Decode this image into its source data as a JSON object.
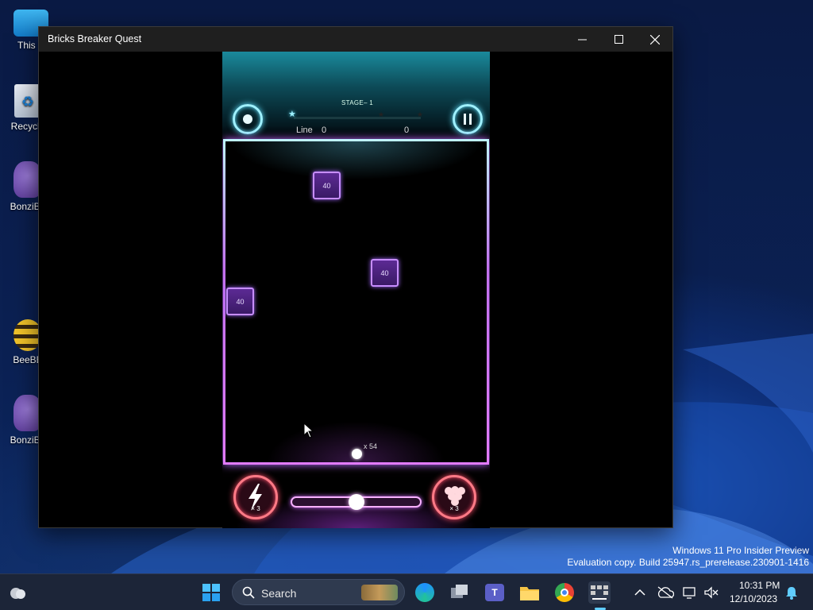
{
  "desktop": {
    "icons": [
      {
        "label": "This P"
      },
      {
        "label": "Recycle"
      },
      {
        "label": "BonziBu"
      },
      {
        "label": "BeeBE"
      },
      {
        "label": "BonziBu"
      }
    ],
    "watermark_line1": "Windows 11 Pro Insider Preview",
    "watermark_line2": "Evaluation copy. Build 25947.rs_prerelease.230901-1416"
  },
  "window": {
    "title": "Bricks Breaker Quest",
    "minimize_icon": "minimize-icon",
    "maximize_icon": "maximize-icon",
    "close_icon": "close-icon"
  },
  "game": {
    "stage_label": "STAGE– 1",
    "line_label": "Line",
    "line_value": "0",
    "score_value": "0",
    "stage_progress": 0,
    "bricks": [
      {
        "value": "40"
      },
      {
        "value": "40"
      },
      {
        "value": "40"
      }
    ],
    "ball_count": "x 54",
    "lightning_count": "× 3",
    "multiball_count": "× 3",
    "aim_slider_level": 0.5,
    "colors": {
      "accent_cyan": "#9ff1ff",
      "accent_pink": "#e27bff",
      "brick": "#5c2a94"
    }
  },
  "taskbar": {
    "search_placeholder": "Search",
    "time": "10:31 PM",
    "date": "12/10/2023"
  }
}
